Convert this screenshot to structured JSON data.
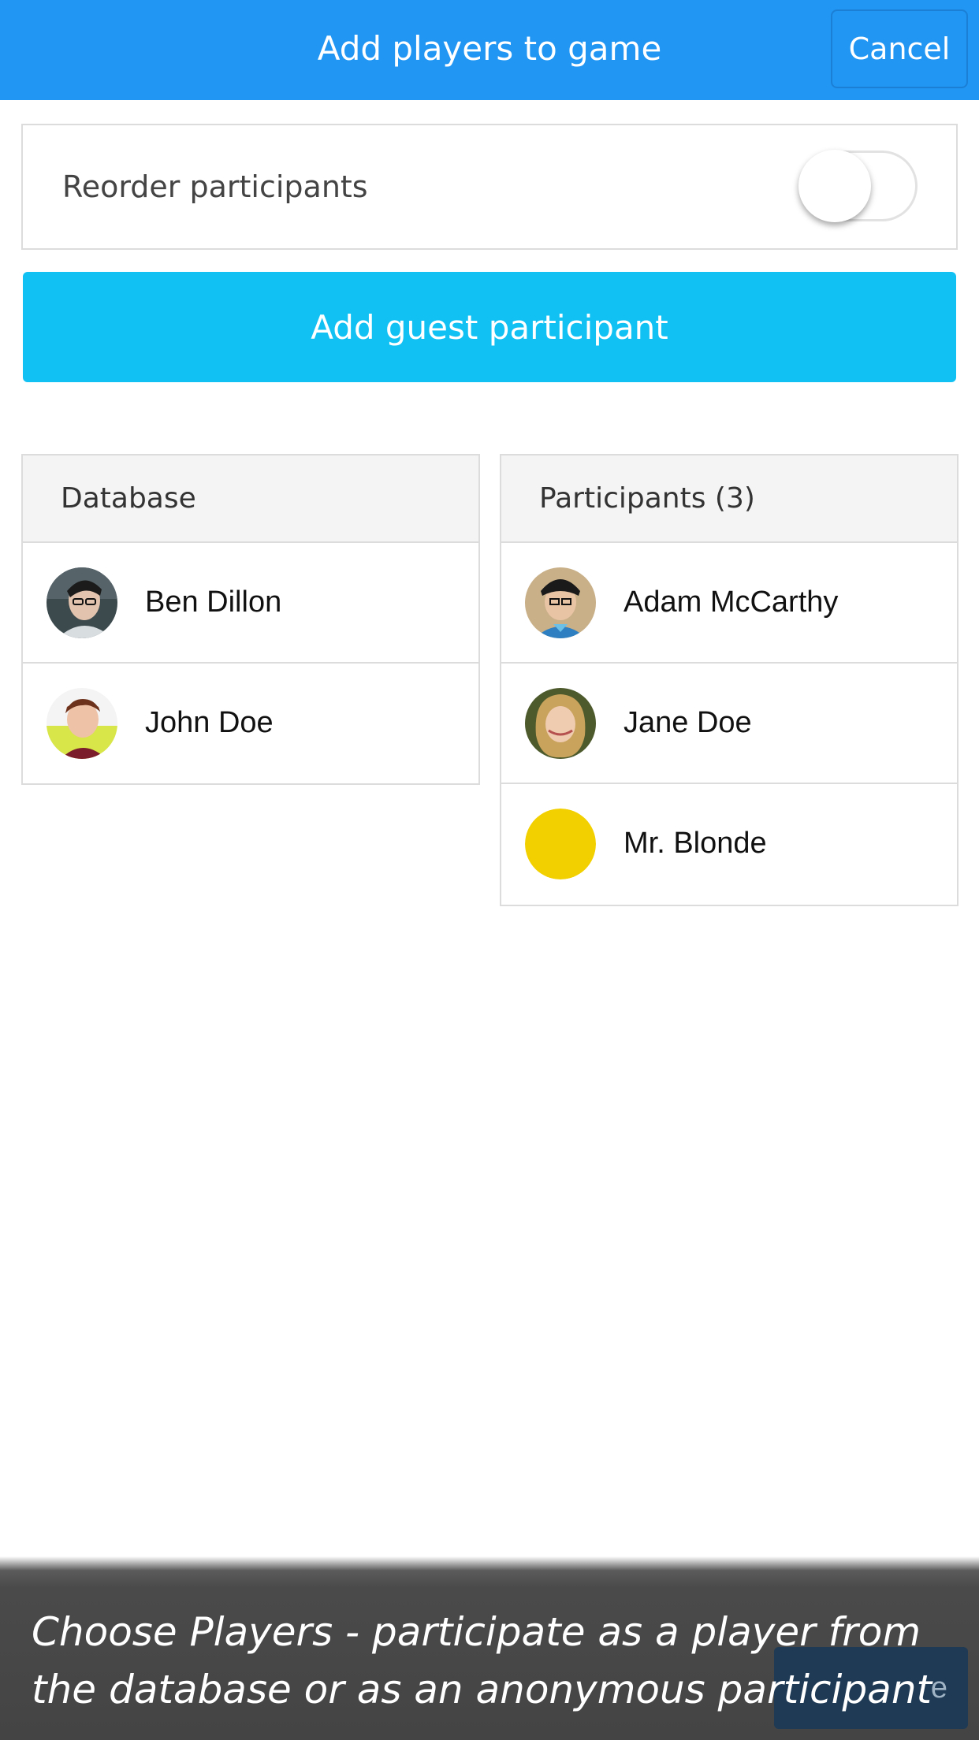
{
  "header": {
    "title": "Add players to game",
    "cancel_label": "Cancel",
    "color": "#2196f3"
  },
  "reorder": {
    "label": "Reorder participants",
    "enabled": false
  },
  "guest_button": {
    "label": "Add guest participant",
    "color": "#11c1f3"
  },
  "database": {
    "header": "Database",
    "items": [
      {
        "name": "Ben Dillon",
        "avatar": "photo-avatar"
      },
      {
        "name": "John Doe",
        "avatar": "photo-avatar"
      }
    ]
  },
  "participants": {
    "header": "Participants (3)",
    "items": [
      {
        "name": "Adam McCarthy",
        "avatar": "photo-avatar"
      },
      {
        "name": "Jane Doe",
        "avatar": "photo-avatar"
      },
      {
        "name": "Mr. Blonde",
        "avatar": "color-avatar",
        "color": "#f2d000"
      }
    ]
  },
  "caption": {
    "line1": "Choose Players - participate as a player from",
    "line2": "the database or as an anonymous participant",
    "hidden_button_label": "e"
  }
}
